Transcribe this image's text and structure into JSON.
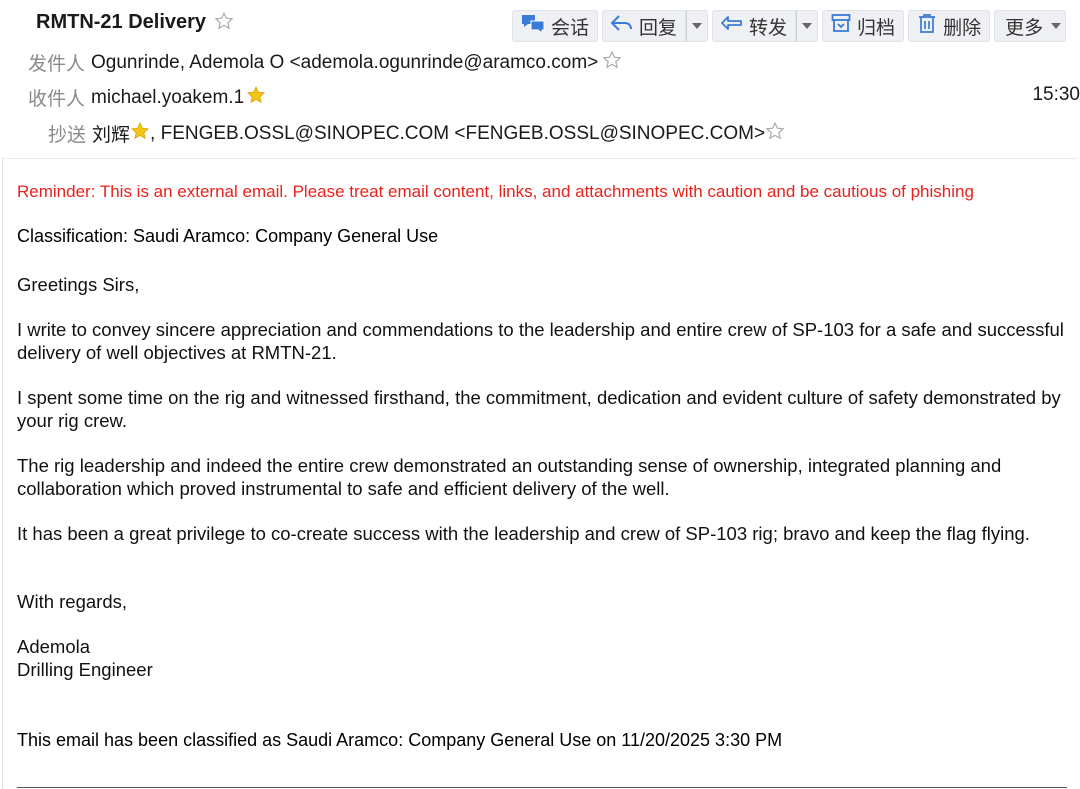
{
  "email": {
    "subject": "RMTN-21 Delivery",
    "from_label": "发件人",
    "from_value": "Ogunrinde, Ademola O <ademola.ogunrinde@aramco.com>",
    "to_label": "收件人",
    "to_value": "michael.yoakem.1",
    "time": "15:30",
    "cc_label": "抄送",
    "cc_name": "刘辉",
    "cc_rest": ", FENGEB.OSSL@SINOPEC.COM <FENGEB.OSSL@SINOPEC.COM>"
  },
  "toolbar": {
    "conversation": "会话",
    "reply": "回复",
    "forward": "转发",
    "archive": "归档",
    "delete": "删除",
    "more": "更多"
  },
  "body": {
    "reminder": "Reminder: This is an external email. Please treat email content, links, and attachments with caution and be cautious of phishing",
    "classification": "Classification: Saudi Aramco: Company General Use",
    "greeting": "Greetings Sirs,",
    "paragraph_1": "I write to convey sincere appreciation and commendations to the leadership and entire crew of SP-103 for a safe and successful delivery of well objectives at RMTN-21.",
    "paragraph_2": "I spent some time on the rig and witnessed firsthand, the commitment, dedication and evident culture of safety demonstrated by your rig crew.",
    "paragraph_3": "The rig leadership and indeed the entire crew demonstrated an outstanding sense of ownership, integrated planning and collaboration which proved instrumental to safe and efficient delivery of the well.",
    "paragraph_4": "It has been a great privilege to co-create success with the leadership and crew of SP-103 rig; bravo and keep the flag flying.",
    "regards": "With regards,",
    "signature_name": "Ademola",
    "signature_title": "Drilling Engineer",
    "footer": "This email has been classified as Saudi Aramco: Company General Use on 11/20/2025 3:30 PM"
  },
  "colors": {
    "reminder": "#e8221d",
    "label": "#8a8a8a",
    "icon_blue": "#3a7bd5",
    "star_gold": "#f5c518"
  },
  "icons": [
    "star-outline-icon",
    "star-filled-icon",
    "conversation-icon",
    "reply-icon",
    "forward-icon",
    "archive-icon",
    "delete-icon",
    "chevron-down-icon"
  ]
}
